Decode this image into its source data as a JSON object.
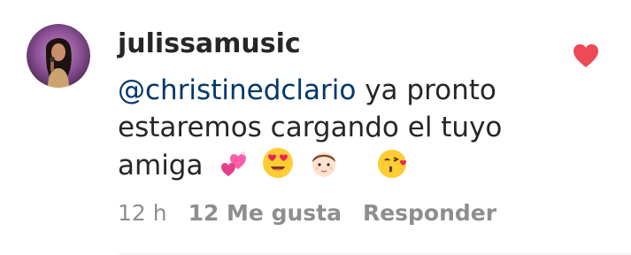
{
  "comment": {
    "username": "julissamusic",
    "mention": "@christinedclario",
    "text_line1_rest": " ya pronto",
    "text_line2": "estaremos cargando el tuyo",
    "text_line3": "amiga",
    "emojis": [
      "two-hearts-emoji",
      "heart-eyes-emoji",
      "boy-emoji",
      "kissing-heart-emoji"
    ],
    "like_icon": "heart-filled-icon",
    "like_color": "#ed4956",
    "mention_color": "#00376b"
  },
  "meta": {
    "time": "12 h",
    "likes": "12 Me gusta",
    "reply": "Responder"
  }
}
